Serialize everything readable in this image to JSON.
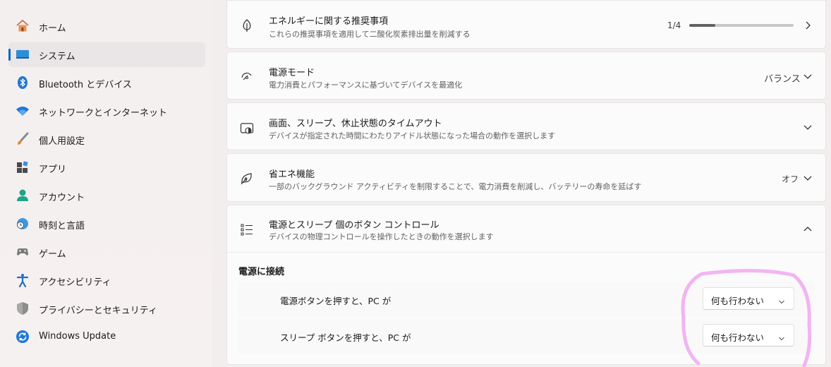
{
  "sidebar": {
    "items": [
      {
        "label": "ホーム",
        "icon": "home-icon",
        "active": false
      },
      {
        "label": "システム",
        "icon": "system-display-icon",
        "active": true
      },
      {
        "label": "Bluetooth とデバイス",
        "icon": "bluetooth-icon",
        "active": false
      },
      {
        "label": "ネットワークとインターネット",
        "icon": "wifi-icon",
        "active": false
      },
      {
        "label": "個人用設定",
        "icon": "paintbrush-icon",
        "active": false
      },
      {
        "label": "アプリ",
        "icon": "apps-icon",
        "active": false
      },
      {
        "label": "アカウント",
        "icon": "account-icon",
        "active": false
      },
      {
        "label": "時刻と言語",
        "icon": "clock-globe-icon",
        "active": false
      },
      {
        "label": "ゲーム",
        "icon": "gamepad-icon",
        "active": false
      },
      {
        "label": "アクセシビリティ",
        "icon": "accessibility-icon",
        "active": false
      },
      {
        "label": "プライバシーとセキュリティ",
        "icon": "shield-icon",
        "active": false
      },
      {
        "label": "Windows Update",
        "icon": "windows-update-icon",
        "active": false
      }
    ]
  },
  "cards": {
    "energy": {
      "title": "エネルギーに関する推奨事項",
      "desc": "これらの推奨事項を適用して二酸化炭素排出量を削減する",
      "progress_text": "1/4",
      "progress": 0.25,
      "icon": "leaf-icon"
    },
    "power_mode": {
      "title": "電源モード",
      "desc": "電力消費とパフォーマンスに基づいてデバイスを最適化",
      "value": "バランス",
      "icon": "power-mode-gauge-icon"
    },
    "screen_sleep": {
      "title": "画面、スリープ、休止状態のタイムアウト",
      "desc": "デバイスが指定された時間にわたりアイドル状態になった場合の動作を選択します",
      "icon": "screen-sleep-icon"
    },
    "energy_saver": {
      "title": "省エネ機能",
      "desc": "一部のバックグラウンド アクティビティを制限することで、電力消費を削減し、バッテリーの寿命を延ばす",
      "value": "オフ",
      "icon": "energy-saver-leaf-icon"
    },
    "buttons": {
      "title": "電源とスリープ 個のボタン コントロール",
      "desc": "デバイスの物理コントロールを操作したときの動作を選択します",
      "icon": "list-icon",
      "section_heading": "電源に接続",
      "rows": [
        {
          "label": "電源ボタンを押すと、PC が",
          "value": "何も行わない"
        },
        {
          "label": "スリープ ボタンを押すと、PC が",
          "value": "何も行わない"
        }
      ]
    }
  },
  "colors": {
    "accent": "#0067c0",
    "annotation": "#f0a8f0"
  }
}
